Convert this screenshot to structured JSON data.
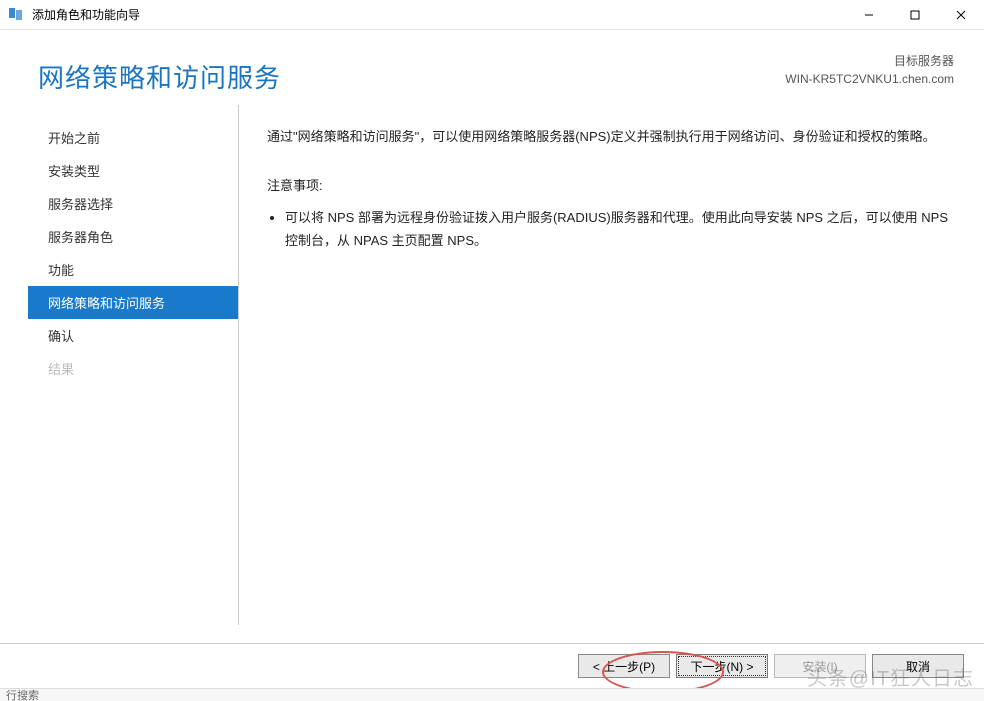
{
  "window": {
    "title": "添加角色和功能向导"
  },
  "header": {
    "title": "网络策略和访问服务",
    "target_label": "目标服务器",
    "target_server": "WIN-KR5TC2VNKU1.chen.com"
  },
  "sidebar": {
    "items": [
      {
        "label": "开始之前",
        "state": "normal"
      },
      {
        "label": "安装类型",
        "state": "normal"
      },
      {
        "label": "服务器选择",
        "state": "normal"
      },
      {
        "label": "服务器角色",
        "state": "normal"
      },
      {
        "label": "功能",
        "state": "normal"
      },
      {
        "label": "网络策略和访问服务",
        "state": "selected"
      },
      {
        "label": "确认",
        "state": "normal"
      },
      {
        "label": "结果",
        "state": "disabled"
      }
    ]
  },
  "content": {
    "intro": "通过\"网络策略和访问服务\"，可以使用网络策略服务器(NPS)定义并强制执行用于网络访问、身份验证和授权的策略。",
    "note_title": "注意事项:",
    "notes": [
      "可以将 NPS 部署为远程身份验证拨入用户服务(RADIUS)服务器和代理。使用此向导安装 NPS 之后，可以使用 NPS 控制台，从 NPAS 主页配置 NPS。"
    ]
  },
  "footer": {
    "prev": "< 上一步(P)",
    "next": "下一步(N) >",
    "install": "安装(I)",
    "cancel": "取消"
  },
  "watermark": "头条@IT狂人日志",
  "statusbar": "行搜索"
}
